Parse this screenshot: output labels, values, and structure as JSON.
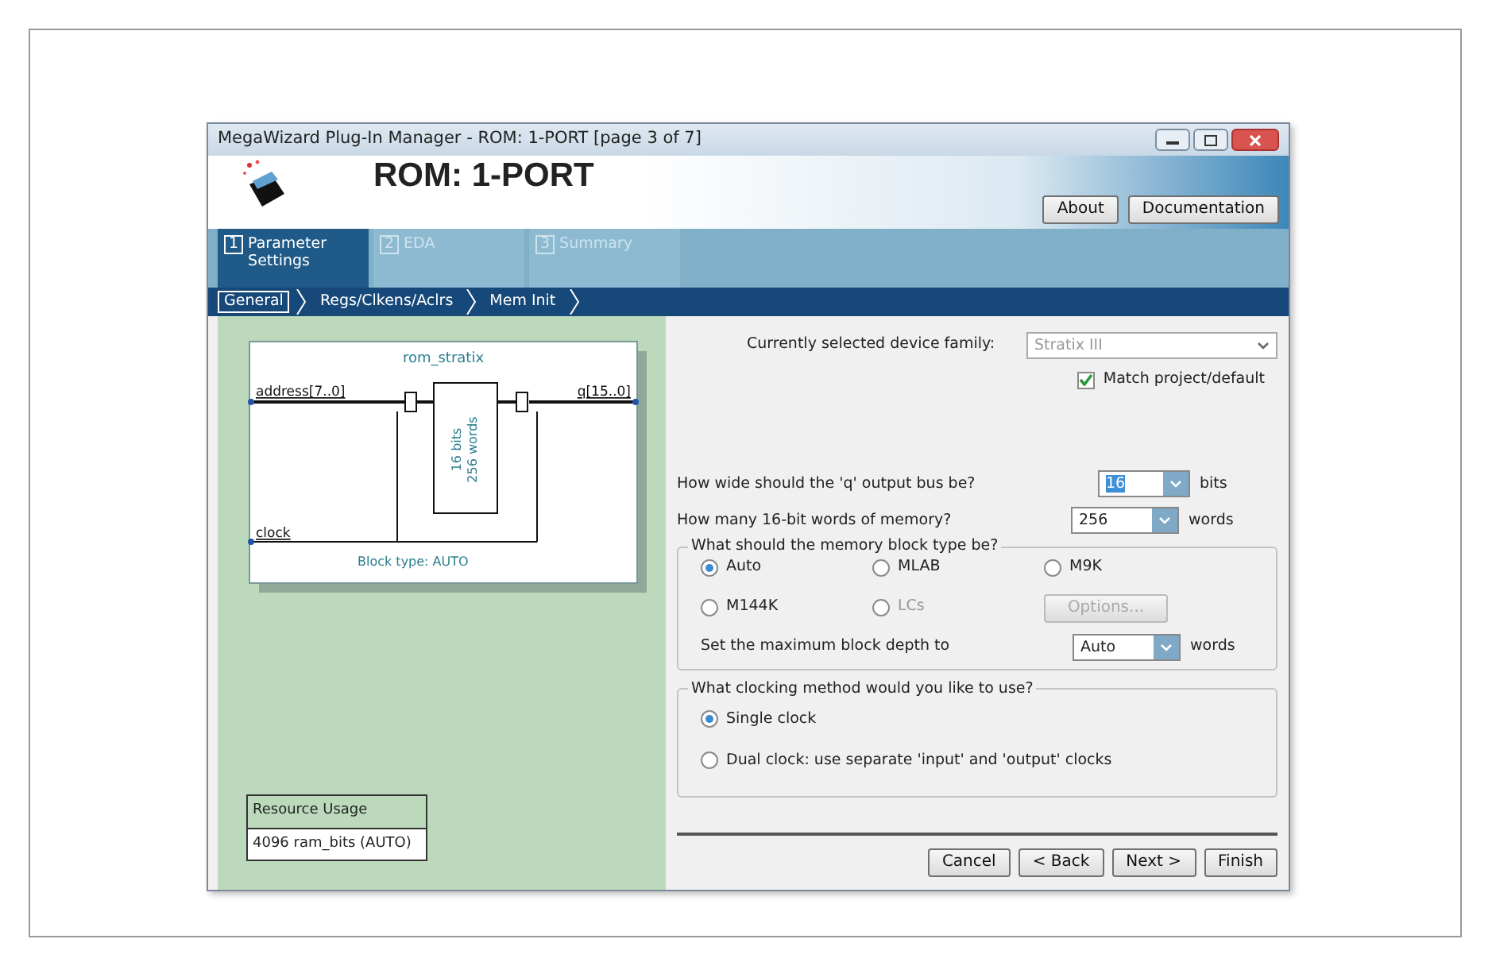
{
  "window": {
    "title": "MegaWizard Plug-In Manager - ROM: 1-PORT [page 3 of 7]"
  },
  "header": {
    "title": "ROM: 1-PORT",
    "buttons": [
      "About",
      "Documentation"
    ]
  },
  "tabs": [
    {
      "number": "1",
      "label": "Parameter Settings",
      "selected": true
    },
    {
      "number": "2",
      "label": "EDA",
      "selected": false
    },
    {
      "number": "3",
      "label": "Summary",
      "selected": false
    }
  ],
  "breadcrumbs": [
    {
      "label": "General",
      "selected": true
    },
    {
      "label": "Regs/Clkens/Aclrs",
      "selected": false
    },
    {
      "label": "Mem Init",
      "selected": false
    }
  ],
  "diagram": {
    "name": "rom_stratix",
    "input": "address[7..0]",
    "output": "q[15..0]",
    "clock": "clock",
    "block_type": "Block type: AUTO",
    "memory_lines": [
      "16 bits",
      "256 words"
    ]
  },
  "resource_usage": {
    "title": "Resource Usage",
    "value": "4096 ram_bits (AUTO)"
  },
  "device_family": {
    "label": "Currently selected device family:",
    "value": "Stratix III",
    "disabled": true
  },
  "match_checkbox": {
    "label": "Match project/default",
    "checked": true
  },
  "q_width": {
    "label": "How wide should the 'q' output bus be?",
    "value": "16",
    "unit": "bits",
    "highlighted": true
  },
  "words": {
    "label": "How many 16-bit words of memory?",
    "value": "256",
    "unit": "words"
  },
  "block_type_group": {
    "title": "What should the memory block type be?",
    "options": [
      {
        "label": "Auto",
        "selected": true,
        "disabled": false
      },
      {
        "label": "MLAB",
        "selected": false,
        "disabled": false
      },
      {
        "label": "M9K",
        "selected": false,
        "disabled": false
      },
      {
        "label": "M144K",
        "selected": false,
        "disabled": false
      },
      {
        "label": "LCs",
        "selected": false,
        "disabled": true
      }
    ],
    "options_button": {
      "label": "Options...",
      "disabled": true
    },
    "depth": {
      "label": "Set the maximum block depth to",
      "value": "Auto",
      "unit": "words"
    }
  },
  "clock_group": {
    "title": "What clocking method would you like to use?",
    "options": [
      {
        "label": "Single clock",
        "selected": true,
        "disabled": false
      },
      {
        "label": "Dual clock: use separate 'input' and 'output' clocks",
        "selected": false,
        "disabled": false
      }
    ]
  },
  "footer_buttons": [
    "Cancel",
    "< Back",
    "Next >",
    "Finish"
  ]
}
